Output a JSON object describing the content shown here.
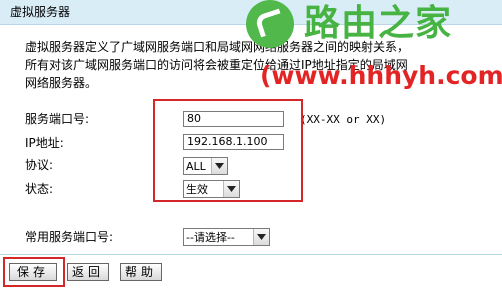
{
  "header": {
    "title": "虚拟服务器"
  },
  "description": {
    "line1": "虚拟服务器定义了广域网服务端口和局域网网络服务器之间的映射关系，",
    "line2": "所有对该广域网服务端口的访问将会被重定位给通过IP地址指定的局域网",
    "line3": "网络服务器。"
  },
  "form": {
    "service_port_label": "服务端口号:",
    "service_port_value": "80",
    "service_port_hint": "(XX-XX or XX)",
    "ip_label": "IP地址:",
    "ip_value": "192.168.1.100",
    "protocol_label": "协议:",
    "protocol_value": "ALL",
    "status_label": "状态:",
    "status_value": "生效",
    "common_port_label": "常用服务端口号:",
    "common_port_value": "--请选择--"
  },
  "buttons": {
    "save": "保存",
    "back": "返回",
    "help": "帮助"
  },
  "watermark": {
    "brand": "路由之家",
    "url": "(www.hhhyh.com)"
  },
  "colors": {
    "highlight": "#d42727",
    "watermark_green": "#46b342",
    "watermark_red": "#e32424",
    "header_background": "#d9edf7"
  }
}
